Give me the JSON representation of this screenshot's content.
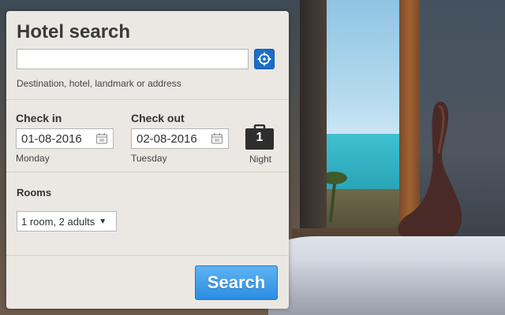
{
  "hotel_search": {
    "title": "Hotel search",
    "destination": {
      "value": "",
      "placeholder": "",
      "hint": "Destination, hotel, landmark or address",
      "locate_icon": "crosshair-icon"
    },
    "check_in": {
      "label": "Check in",
      "date": "01-08-2016",
      "weekday": "Monday"
    },
    "check_out": {
      "label": "Check out",
      "date": "02-08-2016",
      "weekday": "Tuesday"
    },
    "nights": {
      "count": "1",
      "label": "Night",
      "icon": "suitcase-icon"
    },
    "rooms": {
      "label": "Rooms",
      "selected": "1 room, 2 adults"
    },
    "search_button": "Search"
  },
  "colors": {
    "panel_bg": "#ebe8e3",
    "accent_blue": "#2a8de2",
    "text": "#333333"
  }
}
